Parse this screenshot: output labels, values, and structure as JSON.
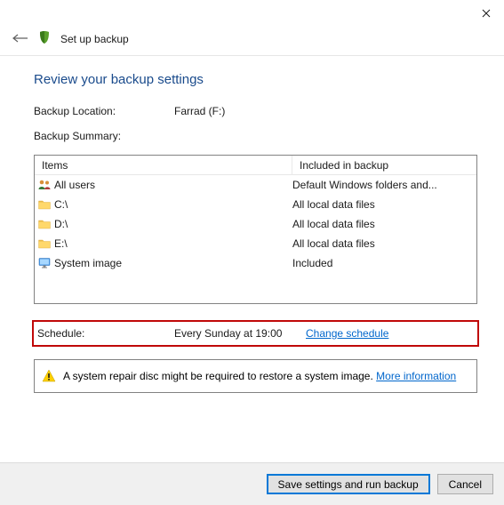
{
  "window_title": "Set up backup",
  "page_title": "Review your backup settings",
  "backup_location_label": "Backup Location:",
  "backup_location_value": "Farrad (F:)",
  "backup_summary_label": "Backup Summary:",
  "columns": {
    "items": "Items",
    "included": "Included in backup"
  },
  "rows": [
    {
      "icon": "users",
      "item": "All users",
      "included": "Default Windows folders and..."
    },
    {
      "icon": "folder",
      "item": "C:\\",
      "included": "All local data files"
    },
    {
      "icon": "folder",
      "item": "D:\\",
      "included": "All local data files"
    },
    {
      "icon": "folder",
      "item": "E:\\",
      "included": "All local data files"
    },
    {
      "icon": "monitor",
      "item": "System image",
      "included": "Included"
    }
  ],
  "schedule": {
    "label": "Schedule:",
    "value": "Every Sunday at 19:00",
    "link": "Change schedule"
  },
  "warning": {
    "text": "A system repair disc might be required to restore a system image. ",
    "link": "More information"
  },
  "buttons": {
    "primary": "Save settings and run backup",
    "cancel": "Cancel"
  }
}
